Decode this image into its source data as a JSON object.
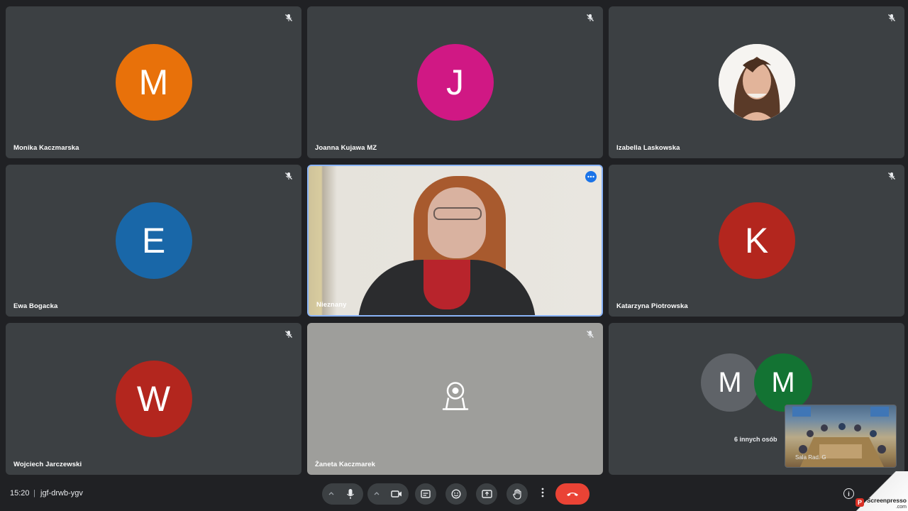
{
  "participants": [
    {
      "name": "Monika Kaczmarska",
      "initial": "M",
      "color": "#e8710a"
    },
    {
      "name": "Joanna Kujawa MZ",
      "initial": "J",
      "color": "#d01884"
    },
    {
      "name": "Izabella Laskowska"
    },
    {
      "name": "Ewa Bogacka",
      "initial": "E",
      "color": "#1967a8"
    },
    {
      "name": "Nieznany"
    },
    {
      "name": "Katarzyna Piotrowska",
      "initial": "K",
      "color": "#b3261e"
    },
    {
      "name": "Wojciech Jarczewski",
      "initial": "W",
      "color": "#b3261e"
    },
    {
      "name": "Żaneta Kaczmarek"
    }
  ],
  "others": {
    "avatars": [
      {
        "initial": "M",
        "color": "#5f6368"
      },
      {
        "initial": "M",
        "color": "#137333"
      }
    ],
    "label": "6 innych osób"
  },
  "pip": {
    "label": "Sala Rad. G"
  },
  "bottombar": {
    "time": "15:20",
    "separator": "|",
    "meeting_code": "jgf-drwb-ygv",
    "controls": [
      "more-options-up",
      "microphone",
      "camera",
      "captions",
      "reactions",
      "present",
      "raise-hand",
      "more-options",
      "leave-call"
    ],
    "info_glyph": "i"
  },
  "watermark": {
    "title": "Screenpresso",
    "sub": ".com",
    "logo": "P"
  },
  "colors": {
    "tile_bg": "#3c4043",
    "page_bg": "#202124",
    "active_border": "#8ab4f8",
    "end_call": "#ea4335"
  }
}
